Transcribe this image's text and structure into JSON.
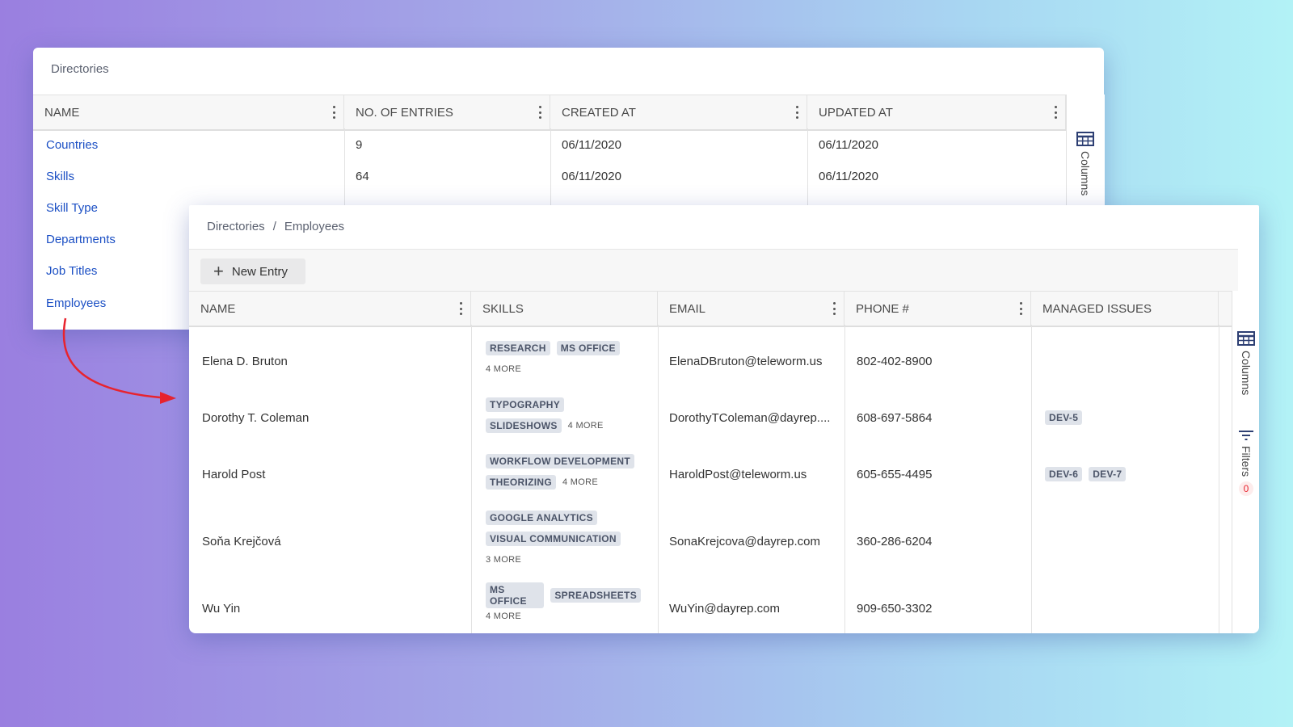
{
  "directories": {
    "title": "Directories",
    "columns": [
      "NAME",
      "NO. OF ENTRIES",
      "CREATED AT",
      "UPDATED AT"
    ],
    "rows": [
      {
        "name": "Countries",
        "entries": "9",
        "created": "06/11/2020",
        "updated": "06/11/2020"
      },
      {
        "name": "Skills",
        "entries": "64",
        "created": "06/11/2020",
        "updated": "06/11/2020"
      },
      {
        "name": "Skill Type"
      },
      {
        "name": "Departments"
      },
      {
        "name": "Job Titles"
      },
      {
        "name": "Employees"
      }
    ],
    "side_columns_label": "Columns"
  },
  "employees": {
    "breadcrumb": [
      "Directories",
      "/",
      "Employees"
    ],
    "new_entry_label": "New Entry",
    "columns": [
      "NAME",
      "SKILLS",
      "EMAIL",
      "PHONE #",
      "MANAGED ISSUES"
    ],
    "rows": [
      {
        "name": "Elena D. Bruton",
        "skills_line1": [
          "RESEARCH",
          "MS OFFICE"
        ],
        "skills_line2": [],
        "more": "4 MORE",
        "email": "ElenaDBruton@teleworm.us",
        "phone": "802-402-8900",
        "issues": []
      },
      {
        "name": "Dorothy T. Coleman",
        "skills_line1": [
          "TYPOGRAPHY"
        ],
        "skills_line2": [
          "SLIDESHOWS"
        ],
        "more": "4 MORE",
        "email": "DorothyTColeman@dayrep....",
        "phone": "608-697-5864",
        "issues": [
          "DEV-5"
        ]
      },
      {
        "name": "Harold Post",
        "skills_line1": [
          "WORKFLOW DEVELOPMENT"
        ],
        "skills_line2": [
          "THEORIZING"
        ],
        "more": "4 MORE",
        "email": "HaroldPost@teleworm.us",
        "phone": "605-655-4495",
        "issues": [
          "DEV-6",
          "DEV-7"
        ]
      },
      {
        "name": "Soňa Krejčová",
        "skills_line1": [
          "GOOGLE ANALYTICS"
        ],
        "skills_line2": [
          "VISUAL COMMUNICATION"
        ],
        "more": "3 MORE",
        "email": "SonaKrejcova@dayrep.com",
        "phone": "360-286-6204",
        "issues": []
      },
      {
        "name": "Wu Yin",
        "skills_line1": [
          "MS OFFICE",
          "SPREADSHEETS"
        ],
        "skills_line2": [],
        "more": "4 MORE",
        "email": "WuYin@dayrep.com",
        "phone": "909-650-3302",
        "issues": []
      }
    ],
    "side_columns_label": "Columns",
    "side_filters_label": "Filters",
    "filters_count": "0"
  },
  "colors": {
    "link": "#1b4fc4",
    "arrow": "#e8232e",
    "badge": "#e8232e"
  }
}
